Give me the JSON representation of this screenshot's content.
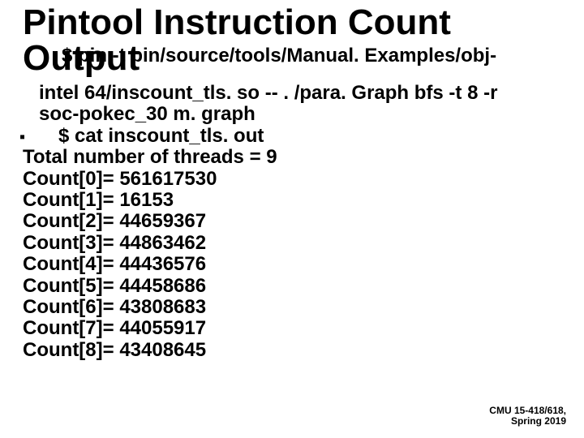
{
  "title": {
    "line1": "Pintool Instruction Count",
    "line2": "Output"
  },
  "commands": {
    "cmd1_overlap": "$ pin -t pin/source/tools/Manual. Examples/obj-",
    "cmd1_cont": "intel 64/inscount_tls. so -- . /para. Graph bfs -t 8 -r",
    "cmd1_cont2": "soc-pokec_30 m. graph",
    "cmd2": "$ cat inscount_tls. out"
  },
  "output": {
    "threads_line": "Total number of threads = 9",
    "counts": [
      "Count[0]= 561617530",
      "Count[1]= 16153",
      "Count[2]= 44659367",
      "Count[3]= 44863462",
      "Count[4]= 44436576",
      "Count[5]= 44458686",
      "Count[6]= 43808683",
      "Count[7]= 44055917",
      "Count[8]= 43408645"
    ]
  },
  "footer": {
    "line1": "CMU 15-418/618,",
    "line2": "Spring 2019"
  }
}
